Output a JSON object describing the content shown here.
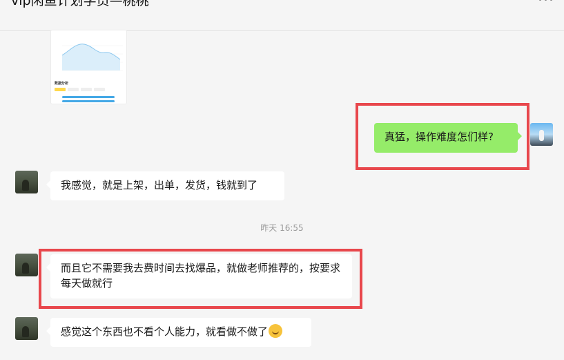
{
  "header": {
    "title": "vip闲鱼计划学员—桃桃",
    "more_label": "···"
  },
  "thumbnail": {
    "section_title": "数据分析"
  },
  "messages": [
    {
      "direction": "out",
      "text": "真猛，操作难度怎们样?"
    },
    {
      "direction": "in",
      "text": "我感觉，就是上架，出单，发货，钱就到了"
    },
    {
      "direction": "in",
      "text": "而且它不需要我去费时间去找爆品，就做老师推荐的，按要求每天做就行"
    },
    {
      "direction": "in",
      "text": "感觉这个东西也不看个人能力，就看做不做了"
    }
  ],
  "timestamp": "昨天 16:55",
  "emoji": "sweat-smile-emoji",
  "colors": {
    "background": "#f5f5f5",
    "incoming_bubble": "#ffffff",
    "outgoing_bubble": "#95ec69",
    "highlight_border": "#e8474c",
    "timestamp_text": "#9a9a9a"
  }
}
